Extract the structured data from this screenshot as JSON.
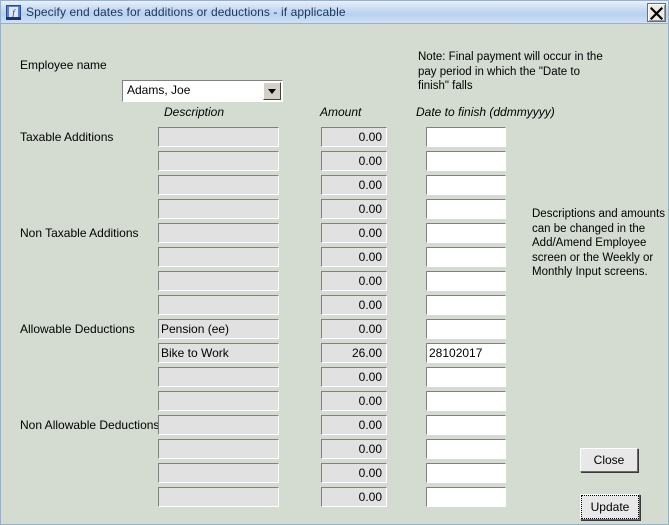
{
  "window": {
    "title": "Specify end dates for additions or deductions - if applicable",
    "icon": "app-icon",
    "close_icon": "close-icon"
  },
  "form": {
    "employee_label": "Employee name",
    "employee_value": "Adams, Joe",
    "dropdown_icon": "chevron-down-icon",
    "note_text": "Note: Final payment will occur in the pay period in which the \"Date to finish\" falls",
    "hint_text": "Descriptions and amounts can be changed in the Add/Amend Employee screen or the Weekly or Monthly Input screens.",
    "headers": {
      "description": "Description",
      "amount": "Amount",
      "date": "Date to finish (ddmmyyyy)"
    },
    "groups": [
      {
        "label": "Taxable Additions",
        "rows": [
          {
            "description": "",
            "amount": "0.00",
            "date": ""
          },
          {
            "description": "",
            "amount": "0.00",
            "date": ""
          },
          {
            "description": "",
            "amount": "0.00",
            "date": ""
          },
          {
            "description": "",
            "amount": "0.00",
            "date": ""
          }
        ]
      },
      {
        "label": "Non Taxable Additions",
        "rows": [
          {
            "description": "",
            "amount": "0.00",
            "date": ""
          },
          {
            "description": "",
            "amount": "0.00",
            "date": ""
          },
          {
            "description": "",
            "amount": "0.00",
            "date": ""
          },
          {
            "description": "",
            "amount": "0.00",
            "date": ""
          }
        ]
      },
      {
        "label": "Allowable Deductions",
        "rows": [
          {
            "description": "Pension (ee)",
            "amount": "0.00",
            "date": ""
          },
          {
            "description": "Bike to Work",
            "amount": "26.00",
            "date": "28102017"
          },
          {
            "description": "",
            "amount": "0.00",
            "date": ""
          },
          {
            "description": "",
            "amount": "0.00",
            "date": ""
          }
        ]
      },
      {
        "label": "Non Allowable Deductions",
        "rows": [
          {
            "description": "",
            "amount": "0.00",
            "date": ""
          },
          {
            "description": "",
            "amount": "0.00",
            "date": ""
          },
          {
            "description": "",
            "amount": "0.00",
            "date": ""
          },
          {
            "description": "",
            "amount": "0.00",
            "date": ""
          }
        ]
      }
    ]
  },
  "buttons": {
    "close": "Close",
    "update": "Update"
  },
  "colors": {
    "window_bg": "#d4dcd2",
    "title_bar": "#b9d1ef",
    "title_text": "#17365d",
    "field_bg": "#e1e1e1",
    "date_field_bg": "#ffffff"
  }
}
